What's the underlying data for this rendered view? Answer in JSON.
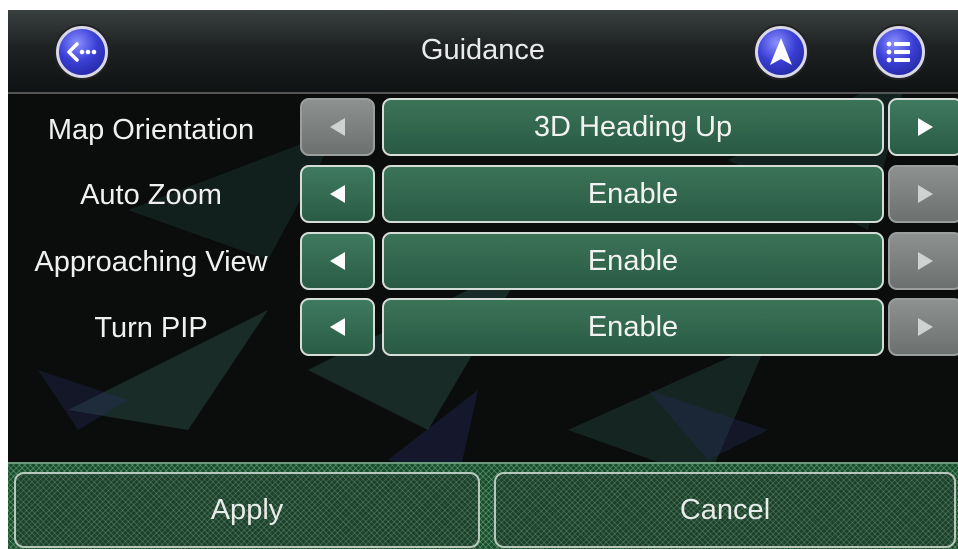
{
  "header": {
    "title": "Guidance",
    "back_icon": "back-ellipsis-icon",
    "navigate_icon": "navigation-arrow-icon",
    "menu_icon": "list-menu-icon"
  },
  "settings": [
    {
      "label": "Map Orientation",
      "value": "3D Heading Up",
      "left_enabled": false,
      "right_enabled": true
    },
    {
      "label": "Auto Zoom",
      "value": "Enable",
      "left_enabled": true,
      "right_enabled": false
    },
    {
      "label": "Approaching View",
      "value": "Enable",
      "left_enabled": true,
      "right_enabled": false
    },
    {
      "label": "Turn PIP",
      "value": "Enable",
      "left_enabled": true,
      "right_enabled": false
    }
  ],
  "footer": {
    "apply_label": "Apply",
    "cancel_label": "Cancel"
  },
  "colors": {
    "accent_green": "#2f6a50",
    "disabled_gray": "#7d817f",
    "icon_blue": "#3a3fd6"
  }
}
